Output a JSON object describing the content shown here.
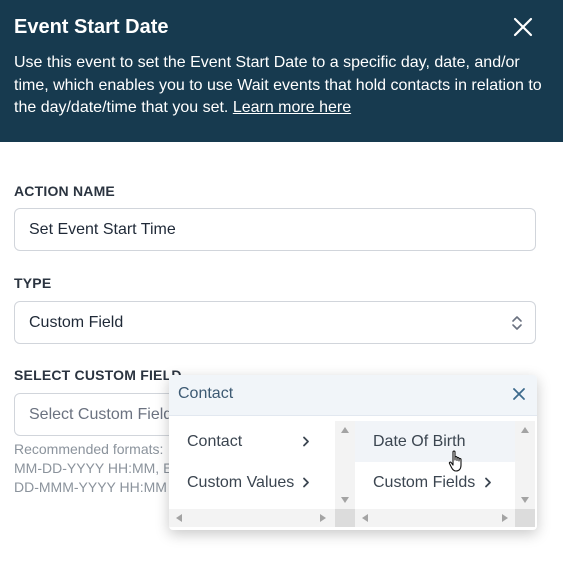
{
  "header": {
    "title": "Event Start Date",
    "description": "Use this event to set the Event Start Date to a specific day, date, and/or time, which enables you to use Wait events that hold contacts in relation to the day/date/time that you set.",
    "link_text": "Learn more here",
    "background": "#173a4f"
  },
  "form": {
    "action_name_label": "ACTION NAME",
    "action_name_value": "Set Event Start Time",
    "type_label": "TYPE",
    "type_value": "Custom Field",
    "custom_field_label": "SELECT CUSTOM FIELD",
    "custom_field_placeholder": "Select Custom Field",
    "hint_line1": "Recommended formats:",
    "hint_line2": "MM-DD-YYYY HH:MM, E",
    "hint_line3": "DD-MMM-YYYY HH:MM"
  },
  "popup": {
    "title": "Contact",
    "left_items": [
      {
        "label": "Contact"
      },
      {
        "label": "Custom Values"
      }
    ],
    "right_items": [
      {
        "label": "Date Of Birth"
      },
      {
        "label": "Custom Fields"
      }
    ]
  },
  "icons": {
    "close": "close-icon",
    "select_arrows": "select-arrows-icon",
    "chevron": "chevron-right-icon",
    "cursor": "hand-pointer-icon"
  }
}
